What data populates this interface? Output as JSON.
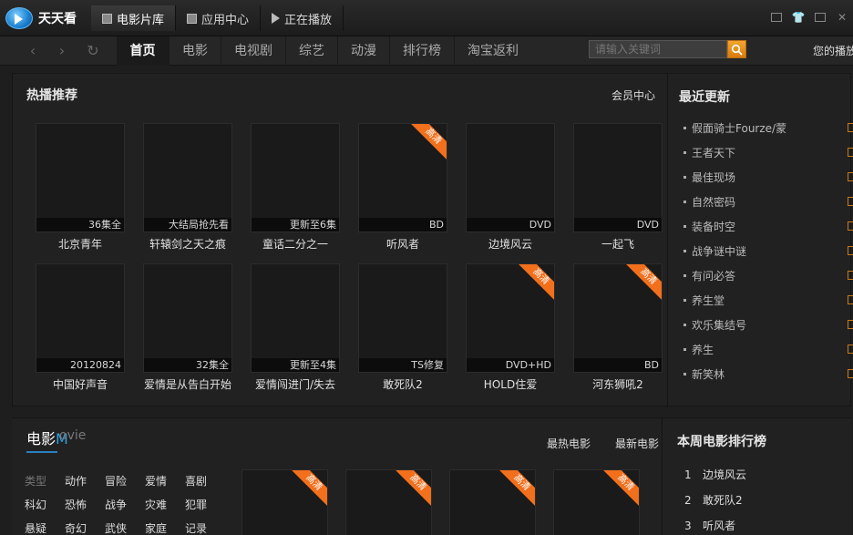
{
  "app": {
    "name": "天天看"
  },
  "top_tabs": [
    {
      "label": "电影片库",
      "icon": "film-library-icon"
    },
    {
      "label": "应用中心",
      "icon": "app-center-icon"
    },
    {
      "label": "正在播放",
      "icon": "play-icon"
    }
  ],
  "window_controls": [
    "skin-icon",
    "shirt-icon",
    "minimize-icon",
    "close-icon"
  ],
  "nav": {
    "back": "‹",
    "forward": "›",
    "refresh": "↻",
    "items": [
      "首页",
      "电影",
      "电视剧",
      "综艺",
      "动漫",
      "排行榜",
      "淘宝返利"
    ],
    "search_placeholder": "请输入关键词",
    "history_label": "您的播放"
  },
  "hot": {
    "title": "热播推荐",
    "member": "会员中心",
    "row1": [
      {
        "title": "北京青年",
        "status": "36集全",
        "hd": false
      },
      {
        "title": "轩辕剑之天之痕",
        "status": "大结局抢先看",
        "hd": false
      },
      {
        "title": "童话二分之一",
        "status": "更新至6集",
        "hd": false
      },
      {
        "title": "听风者",
        "status": "BD",
        "hd": true
      },
      {
        "title": "边境风云",
        "status": "DVD",
        "hd": false
      },
      {
        "title": "一起飞",
        "status": "DVD",
        "hd": false
      }
    ],
    "row2": [
      {
        "title": "中国好声音",
        "status": "20120824",
        "hd": false
      },
      {
        "title": "爱情是从告白开始",
        "status": "32集全",
        "hd": false
      },
      {
        "title": "爱情闯进门/失去",
        "status": "更新至4集",
        "hd": false
      },
      {
        "title": "敢死队2",
        "status": "TS修复",
        "hd": false
      },
      {
        "title": "HOLD住爱",
        "status": "DVD+HD",
        "hd": true
      },
      {
        "title": "河东狮吼2",
        "status": "BD",
        "hd": true
      }
    ],
    "hd_label": "高清"
  },
  "recent": {
    "title": "最近更新",
    "items": [
      "假面骑士Fourze/蒙",
      "王者天下",
      "最佳现场",
      "自然密码",
      "装备时空",
      "战争谜中谜",
      "有问必答",
      "养生堂",
      "欢乐集结号",
      "养生",
      "新笑林"
    ]
  },
  "movie": {
    "title": "电影",
    "title_m": "M",
    "title_rest": "ovie",
    "links": [
      "最热电影",
      "最新电影"
    ],
    "genres": [
      [
        "类型",
        "动作",
        "冒险",
        "爱情",
        "喜剧"
      ],
      [
        "科幻",
        "恐怖",
        "战争",
        "灾难",
        "犯罪"
      ],
      [
        "悬疑",
        "奇幻",
        "武侠",
        "家庭",
        "记录"
      ]
    ],
    "ranking_title": "本周电影排行榜",
    "ranking": [
      {
        "n": "1",
        "title": "边境风云"
      },
      {
        "n": "2",
        "title": "敢死队2"
      },
      {
        "n": "3",
        "title": "听风者"
      }
    ]
  }
}
